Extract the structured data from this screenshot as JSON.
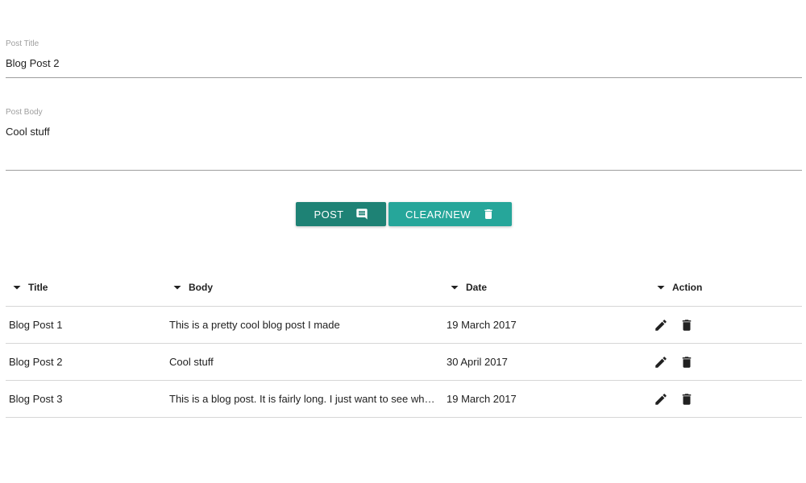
{
  "form": {
    "title_label": "Post Title",
    "title_value": "Blog Post 2",
    "body_label": "Post Body",
    "body_value": "Cool stuff"
  },
  "buttons": {
    "post_label": "POST",
    "post_icon": "comment-icon",
    "clear_label": "CLEAR/NEW",
    "clear_icon": "trash-icon"
  },
  "colors": {
    "post_button": "#1e8275",
    "clear_button": "#26a69a"
  },
  "table": {
    "headers": [
      "Title",
      "Body",
      "Date",
      "Action"
    ],
    "rows": [
      {
        "title": "Blog Post 1",
        "body": "This is a pretty cool blog post I made",
        "date": "19 March 2017"
      },
      {
        "title": "Blog Post 2",
        "body": "Cool stuff",
        "date": "30 April 2017"
      },
      {
        "title": "Blog Post 3",
        "body": "This is a blog post. It is fairly long. I just want to see what t…",
        "date": "19 March 2017"
      }
    ],
    "row_actions": [
      "edit-icon",
      "delete-icon"
    ]
  }
}
